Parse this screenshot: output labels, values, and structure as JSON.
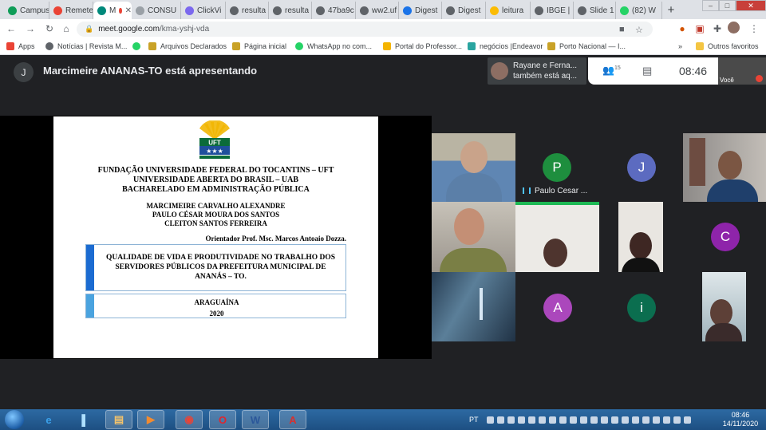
{
  "browser": {
    "tabs": [
      {
        "label": "Campus",
        "favicon": "sheets-icon",
        "color": "#0f9d58"
      },
      {
        "label": "Remeter",
        "favicon": "gmail-icon",
        "color": "#ea4335"
      },
      {
        "label": "M",
        "favicon": "meet-icon",
        "color": "#00897b",
        "active": true
      },
      {
        "label": "CONSU",
        "favicon": "page-icon",
        "color": "#9aa0a6"
      },
      {
        "label": "ClickVi",
        "favicon": "clickup-icon",
        "color": "#7b68ee"
      },
      {
        "label": "resulta",
        "favicon": "globe-icon",
        "color": "#5f6368"
      },
      {
        "label": "resulta",
        "favicon": "globe-icon",
        "color": "#5f6368"
      },
      {
        "label": "47ba9c",
        "favicon": "globe-icon",
        "color": "#5f6368"
      },
      {
        "label": "ww2.uf",
        "favicon": "page-icon",
        "color": "#5f6368"
      },
      {
        "label": "Digest",
        "favicon": "settings-icon",
        "color": "#1a73e8"
      },
      {
        "label": "Digest",
        "favicon": "globe-icon",
        "color": "#5f6368"
      },
      {
        "label": "leitura",
        "favicon": "drive-icon",
        "color": "#fbbc04"
      },
      {
        "label": "IBGE |",
        "favicon": "globe-icon",
        "color": "#5f6368"
      },
      {
        "label": "Slide 1",
        "favicon": "globe-icon",
        "color": "#5f6368"
      },
      {
        "label": "(82) W",
        "favicon": "whatsapp-icon",
        "color": "#25d366"
      }
    ],
    "new_tab": "+",
    "window_buttons": {
      "minimize": "–",
      "maximize": "□",
      "close": "✕"
    },
    "url_host": "meet.google.com",
    "url_path": "/kma-yshj-vda",
    "bookmarks": [
      {
        "label": "Apps",
        "icon": "apps-grid-icon",
        "color": "#ea4335"
      },
      {
        "label": "Notícias | Revista M...",
        "icon": "globe-icon",
        "color": "#5f6368"
      },
      {
        "label": "",
        "icon": "whatsapp-icon",
        "color": "#25d366"
      },
      {
        "label": "Arquivos Declarados",
        "icon": "bookmark-folder-icon",
        "color": "#c9a227"
      },
      {
        "label": "Página inicial",
        "icon": "bookmark-folder-icon",
        "color": "#c9a227"
      },
      {
        "label": "WhatsApp no com...",
        "icon": "whatsapp-icon",
        "color": "#25d366"
      },
      {
        "label": "Portal do Professor...",
        "icon": "portal-icon",
        "color": "#f4b400"
      },
      {
        "label": "negócios |Endeavor",
        "icon": "endeavor-icon",
        "color": "#2aa5a0"
      },
      {
        "label": "Porto Nacional — I...",
        "icon": "bookmark-folder-icon",
        "color": "#c9a227"
      },
      {
        "label": "»",
        "icon": "",
        "color": ""
      },
      {
        "label": "Outros favoritos",
        "icon": "folder-icon",
        "color": "#f4c542"
      }
    ]
  },
  "meet": {
    "presenter_initial": "J",
    "presenter_text": "Marcimeire ANANAS-TO está apresentando",
    "notification_line1": "Rayane e Ferna...",
    "notification_line2": "também está aq...",
    "people_count": "15",
    "clock": "08:46",
    "self_label": "Você"
  },
  "slide": {
    "line1": "FUNDAÇÃO UNIVERSIDADE FEDERAL DO TOCANTINS – UFT",
    "line2": "UNIVERSIDADE ABERTA DO BRASIL – UAB",
    "line3": "BACHARELADO EM ADMINISTRAÇÃO PÚBLICA",
    "author1": "MARCIMEIRE CARVALHO ALEXANDRE",
    "author2": "PAULO CÉSAR MOURA DOS SANTOS",
    "author3": "CLEITON SANTOS FERREIRA",
    "advisor": "Orientador Prof. Msc. Marcos Antoaio Dozza.",
    "title": "QUALIDADE DE VIDA E PRODUTIVIDADE NO TRABALHO DOS SERVIDORES PÚBLICOS DA PREFEITURA MUNICIPAL DE ANANÁS – TO.",
    "city": "ARAGUAÍNA",
    "year": "2020",
    "logo_text": "UFT"
  },
  "participants": {
    "p_initial": "P",
    "p_name": "Paulo Cesar ...",
    "j_initial": "J",
    "c_initial": "C",
    "a_initial": "A",
    "i_initial": "i",
    "colors": {
      "p": "#1e8e3e",
      "j": "#5c6bc0",
      "c": "#8e24aa",
      "a": "#ab47bc",
      "i": "#0b6e4f"
    }
  },
  "taskbar": {
    "apps": [
      {
        "label": "e",
        "icon": "ie-icon",
        "color": "#3aa0ea"
      },
      {
        "label": "▌",
        "icon": "explorer-icon",
        "color": "#aee0ff"
      },
      {
        "label": "▤",
        "icon": "folder-icon",
        "color": "#f3c26b"
      },
      {
        "label": "▶",
        "icon": "media-player-icon",
        "color": "#f28b30"
      },
      {
        "label": "◉",
        "icon": "chrome-icon",
        "color": "#ea4335"
      },
      {
        "label": "O",
        "icon": "opera-icon",
        "color": "#e0262e"
      },
      {
        "label": "W",
        "icon": "word-icon",
        "color": "#2b579a"
      },
      {
        "label": "A",
        "icon": "acrobat-icon",
        "color": "#d9302c"
      }
    ],
    "language": "PT",
    "time": "08:46",
    "date": "14/11/2020"
  }
}
